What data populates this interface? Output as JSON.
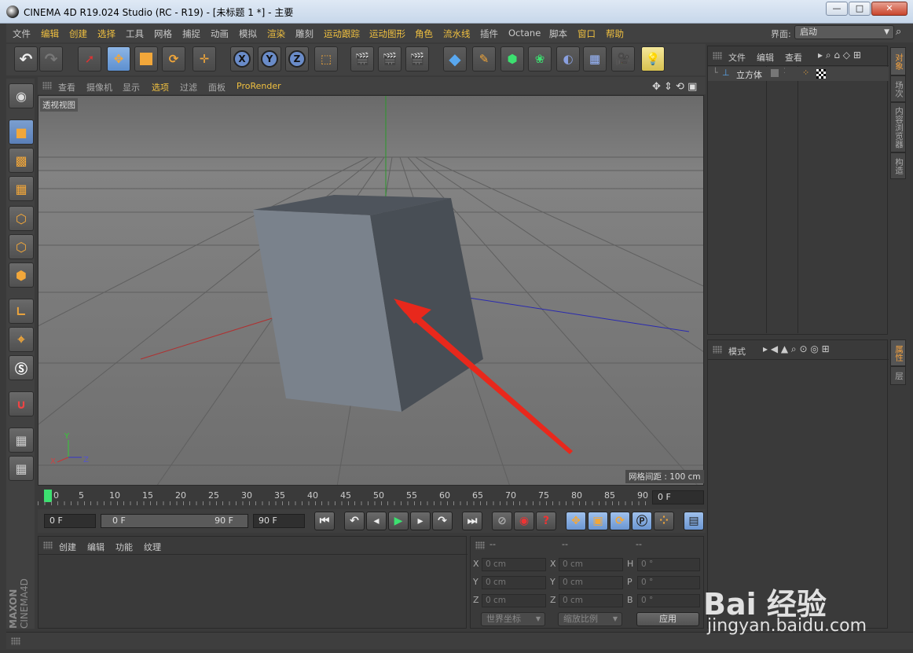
{
  "window": {
    "title": "CINEMA 4D R19.024 Studio (RC - R19) - [未标题 1 *] - 主要",
    "buttons": {
      "minimize": "—",
      "maximize": "□",
      "close": "✕"
    }
  },
  "menubar": {
    "items": [
      "文件",
      "编辑",
      "创建",
      "选择",
      "工具",
      "网格",
      "捕捉",
      "动画",
      "模拟",
      "渲染",
      "雕刻",
      "运动跟踪",
      "运动图形",
      "角色",
      "流水线",
      "插件",
      "Octane",
      "脚本",
      "窗口",
      "帮助"
    ],
    "layout_label": "界面:",
    "layout_value": "启动"
  },
  "toolbar": {
    "undo_icon": "undo-icon",
    "axis_x": "X",
    "axis_y": "Y",
    "axis_z": "Z"
  },
  "viewport": {
    "menu": [
      "查看",
      "摄像机",
      "显示",
      "选项",
      "过滤",
      "面板",
      "ProRender"
    ],
    "label": "透视视图",
    "grid_spacing": "网格间距 : 100 cm",
    "gizmo": {
      "y": "Y",
      "z": "Z",
      "x": "X"
    }
  },
  "timeline": {
    "ticks": [
      "0",
      "5",
      "10",
      "15",
      "20",
      "25",
      "30",
      "35",
      "40",
      "45",
      "50",
      "55",
      "60",
      "65",
      "70",
      "75",
      "80",
      "85",
      "90"
    ],
    "current_frame": "0 F",
    "start_field": "0 F",
    "range_start": "0 F",
    "range_end": "90 F",
    "end_field": "90 F"
  },
  "material_manager": {
    "menu": [
      "创建",
      "编辑",
      "功能",
      "纹理"
    ]
  },
  "coordinates": {
    "headers": [
      "--",
      "--",
      "--"
    ],
    "rows": [
      {
        "a": "X",
        "av": "0 cm",
        "b": "X",
        "bv": "0 cm",
        "c": "H",
        "cv": "0 °"
      },
      {
        "a": "Y",
        "av": "0 cm",
        "b": "Y",
        "bv": "0 cm",
        "c": "P",
        "cv": "0 °"
      },
      {
        "a": "Z",
        "av": "0 cm",
        "b": "Z",
        "bv": "0 cm",
        "c": "B",
        "cv": "0 °"
      }
    ],
    "mode_select": "世界坐标",
    "scale_select": "缩放比例",
    "apply": "应用"
  },
  "object_manager": {
    "menu": [
      "文件",
      "编辑",
      "查看"
    ],
    "objects": [
      {
        "name": "立方体"
      }
    ]
  },
  "attribute_manager": {
    "menu": [
      "模式"
    ]
  },
  "right_tabs": {
    "top": [
      "对象",
      "场次",
      "内容浏览器",
      "构造"
    ],
    "bottom": [
      "属性",
      "层"
    ]
  },
  "brand": {
    "maxon": "MAXON",
    "c4d": "CINEMA4D"
  },
  "watermark": {
    "main": "Bai 经验",
    "sub": "jingyan.baidu.com"
  }
}
